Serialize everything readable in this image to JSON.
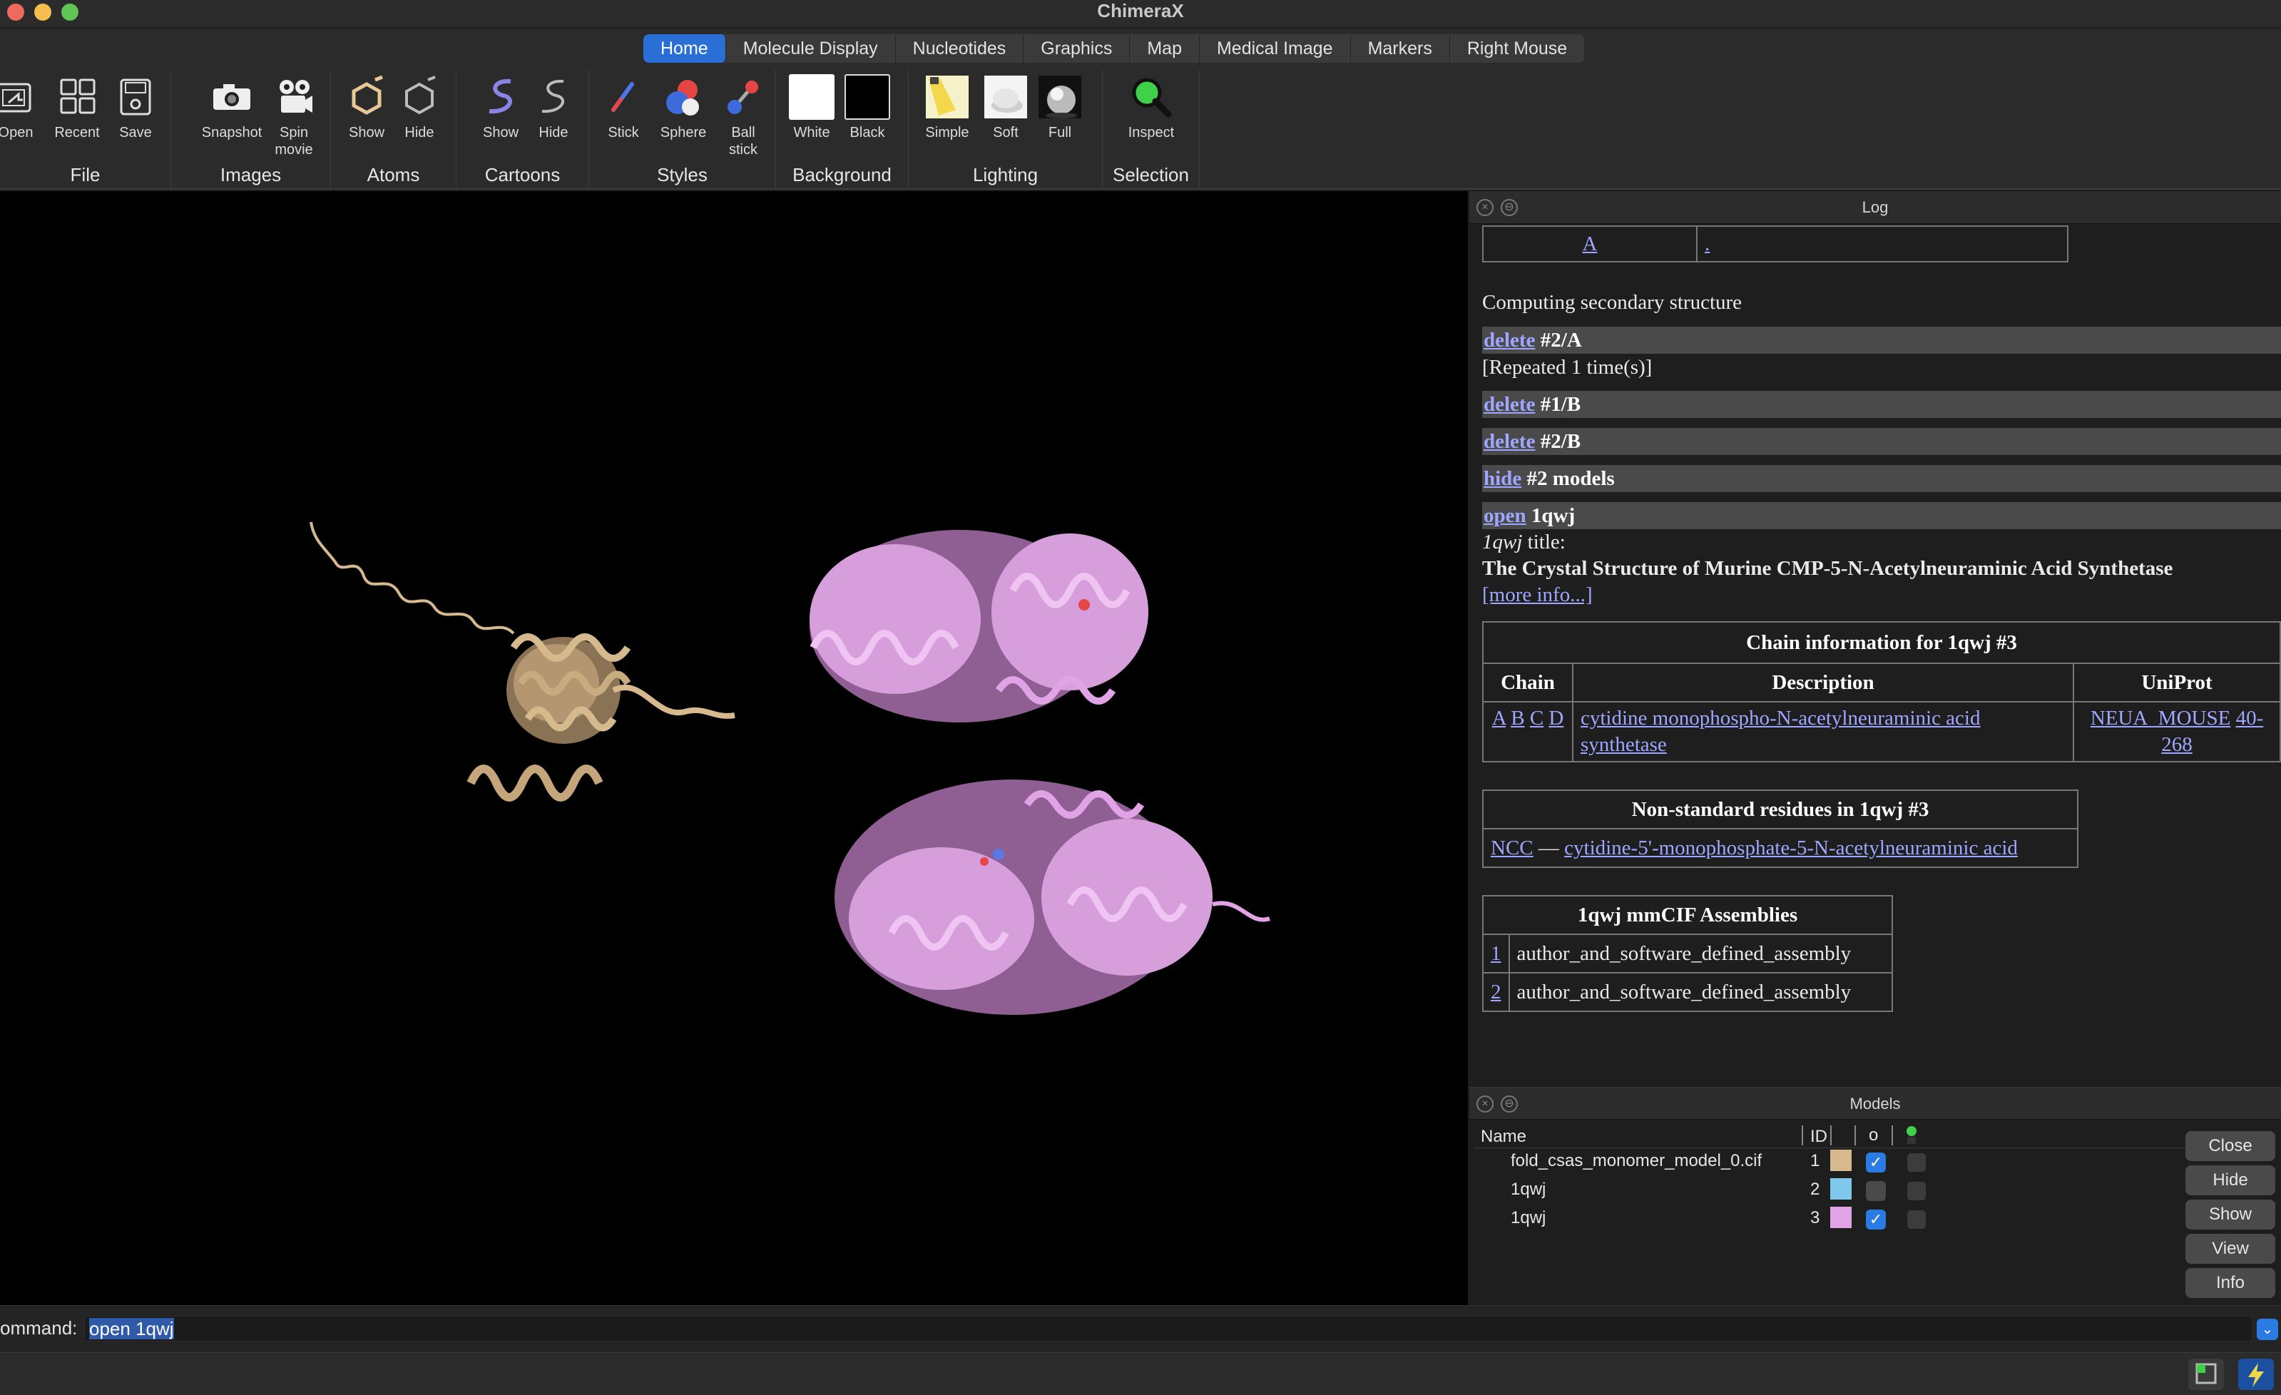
{
  "window": {
    "title": "ChimeraX"
  },
  "colors": {
    "active_tab": "#2a6fd6",
    "link": "#9fa6ff",
    "model_1_color": "#d7b98e",
    "model_2_color": "#7ec8ec",
    "model_3_color": "#e0a4e6",
    "checkbox_on": "#2a7be4"
  },
  "tabs": [
    {
      "label": "Home",
      "active": true
    },
    {
      "label": "Molecule Display"
    },
    {
      "label": "Nucleotides"
    },
    {
      "label": "Graphics"
    },
    {
      "label": "Map"
    },
    {
      "label": "Medical Image"
    },
    {
      "label": "Markers"
    },
    {
      "label": "Right Mouse"
    }
  ],
  "toolbar": {
    "file": {
      "label": "File",
      "open": "Open",
      "recent": "Recent",
      "save": "Save"
    },
    "images": {
      "label": "Images",
      "snapshot": "Snapshot",
      "spin1": "Spin",
      "spin2": "movie"
    },
    "atoms": {
      "label": "Atoms",
      "show": "Show",
      "hide": "Hide"
    },
    "cartoons": {
      "label": "Cartoons",
      "show": "Show",
      "hide": "Hide"
    },
    "styles": {
      "label": "Styles",
      "stick": "Stick",
      "sphere": "Sphere",
      "ball1": "Ball",
      "ball2": "stick"
    },
    "background": {
      "label": "Background",
      "white": "White",
      "black": "Black"
    },
    "lighting": {
      "label": "Lighting",
      "simple": "Simple",
      "soft": "Soft",
      "full": "Full"
    },
    "selection": {
      "label": "Selection",
      "inspect": "Inspect"
    }
  },
  "log": {
    "title": "Log",
    "top_row": {
      "link_a": "A",
      "link_b": "."
    },
    "computing": "Computing secondary structure",
    "entries": [
      {
        "cmd": "delete",
        "args": "#2/A"
      },
      {
        "cmd": "delete",
        "args": "#1/B"
      },
      {
        "cmd": "delete",
        "args": "#2/B"
      },
      {
        "cmd": "hide",
        "args": "#2 models"
      },
      {
        "cmd": "open",
        "args": "1qwj"
      }
    ],
    "repeated": "[Repeated 1 time(s)]",
    "title_name": "1qwj",
    "title_suffix": " title:",
    "structure_title": "The Crystal Structure of Murine CMP-5-N-Acetylneuraminic Acid Synthetase",
    "more_info": "[more info...]",
    "chain_table": {
      "caption": "Chain information for 1qwj #3",
      "headers": [
        "Chain",
        "Description",
        "UniProt"
      ],
      "chains": [
        "A",
        "B",
        "C",
        "D"
      ],
      "description": "cytidine monophospho-N-acetylneuraminic acid synthetase",
      "uniprot": "NEUA_MOUSE",
      "uniprot_range": "40-268"
    },
    "nonstd_table": {
      "caption": "Non-standard residues in 1qwj #3",
      "code": "NCC",
      "dash": " — ",
      "name": "cytidine-5'-monophosphate-5-N-acetylneuraminic acid"
    },
    "assemblies_table": {
      "caption": "1qwj mmCIF Assemblies",
      "rows": [
        {
          "id": "1",
          "name": "author_and_software_defined_assembly"
        },
        {
          "id": "2",
          "name": "author_and_software_defined_assembly"
        }
      ]
    }
  },
  "models": {
    "title": "Models",
    "headers": {
      "name": "Name",
      "id": "ID",
      "vis": "o"
    },
    "rows": [
      {
        "name": "fold_csas_monomer_model_0.cif",
        "id": "1",
        "shown": true
      },
      {
        "name": "1qwj",
        "id": "2",
        "shown": false
      },
      {
        "name": "1qwj",
        "id": "3",
        "shown": true
      }
    ],
    "buttons": [
      "Close",
      "Hide",
      "Show",
      "View",
      "Info"
    ]
  },
  "command": {
    "label": "ommand:",
    "value": "open 1qwj"
  }
}
